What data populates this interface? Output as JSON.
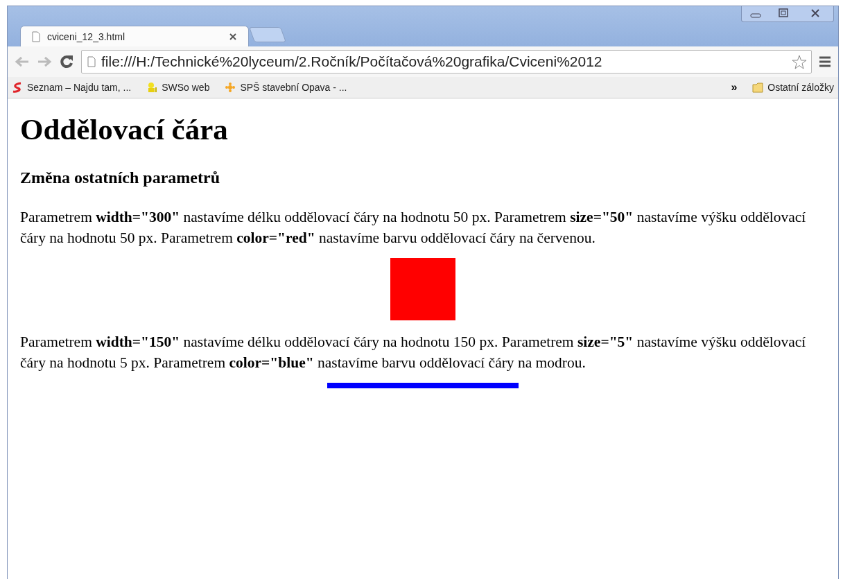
{
  "window": {
    "tab": {
      "title": "cviceni_12_3.html",
      "selected": true
    },
    "address": "file:///H:/Technické%20lyceum/2.Ročník/Počítačová%20grafika/Cviceni%2012",
    "bookmarks": [
      {
        "label": "Seznam – Najdu tam, ...",
        "kind": "seznam"
      },
      {
        "label": "SWSo web",
        "kind": "sws"
      },
      {
        "label": "SPŠ stavební Opava - ...",
        "kind": "star"
      }
    ],
    "overflow": "»",
    "other_bookmarks": "Ostatní záložky"
  },
  "page": {
    "heading": "Oddělovací čára",
    "subheading": "Změna ostatních parametrů",
    "blocks": [
      {
        "text": "Parametrem **width=\"300\"** nastavíme délku oddělovací čáry na hodnotu 50 px. Parametrem **size=\"50\"** nastavíme výšku oddělovací čáry na hodnotu 50 px. Parametrem **color=\"red\"** nastavíme barvu oddělovací čáry na červenou.",
        "rule": {
          "kind": "block",
          "color": "#ff0000"
        }
      },
      {
        "text": "Parametrem **width=\"150\"** nastavíme délku oddělovací čáry na hodnotu 150 px. Parametrem **size=\"5\"** nastavíme výšku oddělovací čáry na hodnotu 5 px. Parametrem **color=\"blue\"** nastavíme barvu oddělovací čáry na modrou.",
        "rule": {
          "kind": "line",
          "color": "#0000ff"
        }
      }
    ]
  }
}
